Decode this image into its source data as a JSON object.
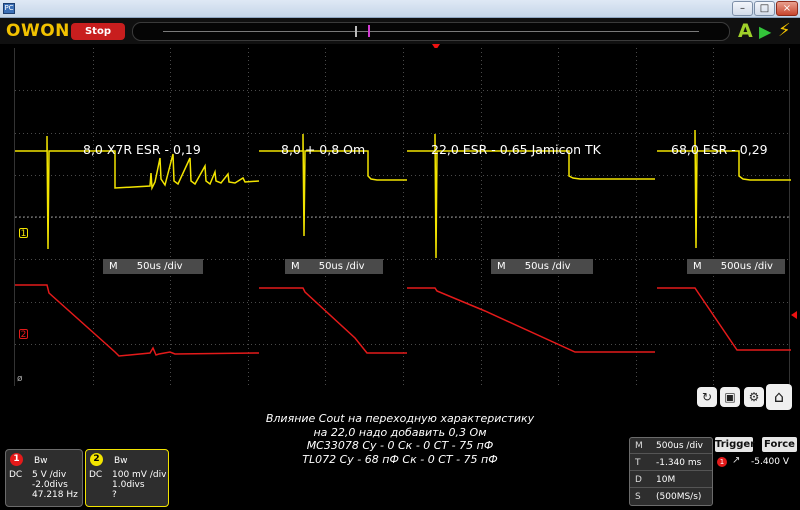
{
  "window": {
    "app_icon": "PC",
    "controls": {
      "minimize": "–",
      "maximize": "□",
      "close": "×"
    }
  },
  "toolbar": {
    "logo": "OWON",
    "stop_label": "Stop",
    "auto_icon": "A",
    "run_icon": "▶",
    "bolt_icon": "⚡"
  },
  "screen": {
    "ch1_marker": "1",
    "ch2_marker": "2",
    "cursor_icon": "ø",
    "traces": [
      {
        "label": "8,0  X7R  ESR - 0,19",
        "timebase": "M      50us /div"
      },
      {
        "label": "8,0 + 0,8 Om",
        "timebase": "M      50us /div"
      },
      {
        "label": "22,0  ESR - 0,65  Jamicon TK",
        "timebase": "M      50us /div"
      },
      {
        "label": "68,0  ESR - 0,29",
        "timebase": "M      500us /div"
      }
    ]
  },
  "note": {
    "lines": [
      "Влияние  Cout  на переходную характеристику",
      "на 22,0 надо добавить 0,3 Ом",
      "MC33078  Су - 0  Ск - 0  СТ - 75 пФ",
      "TL072  Су - 68 пФ Ск - 0  СТ - 75 пФ"
    ]
  },
  "ch1": {
    "num": "1",
    "bw": "Bw",
    "coupling": "DC",
    "vdiv": "5 V /div",
    "offset": "-2.0divs",
    "extra": "47.218 Hz"
  },
  "ch2": {
    "num": "2",
    "bw": "Bw",
    "coupling": "DC",
    "vdiv": "100 mV /div",
    "offset": "1.0divs",
    "extra": "?"
  },
  "tools": {
    "refresh_icon": "↻",
    "save_icon": "▣",
    "gear_icon": "⚙",
    "home_icon": "⌂"
  },
  "timebase_panel": {
    "rows": [
      {
        "k": "M",
        "v": "500us /div"
      },
      {
        "k": "T",
        "v": "-1.340 ms"
      },
      {
        "k": "D",
        "v": "10M"
      },
      {
        "k": "S",
        "v": "(500MS/s)"
      }
    ]
  },
  "trigger": {
    "trigger_label": "Trigger",
    "force_label": "Force",
    "source": "1",
    "edge_icon": "↗",
    "level": "-5.400 V"
  },
  "colors": {
    "ch1": "#f2e400",
    "ch2": "#e41a1a",
    "logo": "#f2c200",
    "stop": "#c81e1e"
  }
}
